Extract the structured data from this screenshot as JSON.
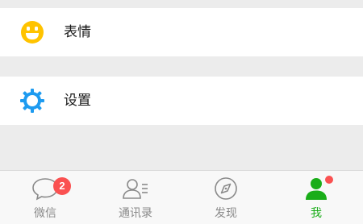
{
  "menu": {
    "emoji_label": "表情",
    "settings_label": "设置"
  },
  "tabs": [
    {
      "label": "微信",
      "badge": "2",
      "icon": "chat-bubble-icon"
    },
    {
      "label": "通讯录",
      "icon": "contacts-icon"
    },
    {
      "label": "发现",
      "icon": "compass-icon"
    },
    {
      "label": "我",
      "icon": "person-icon",
      "active": true,
      "dot": true
    }
  ],
  "colors": {
    "emoji_icon": "#ffc300",
    "settings_icon": "#1e9bf0",
    "active_tab": "#1aad19",
    "badge": "#fa5151",
    "inactive_tab": "#8a8a8a"
  }
}
